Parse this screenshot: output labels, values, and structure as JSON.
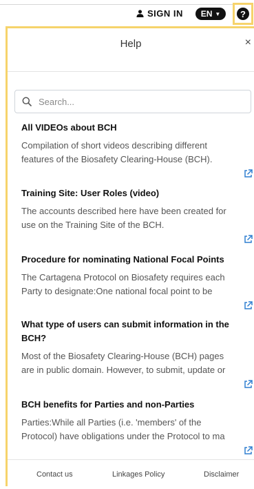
{
  "topbar": {
    "signin_label": "SIGN IN",
    "language": "EN",
    "help_icon": "question-circle-icon"
  },
  "help_panel": {
    "title": "Help",
    "close_symbol": "×",
    "search": {
      "placeholder": "Search..."
    },
    "articles": [
      {
        "title": "All VIDEOs about BCH",
        "description": "Compilation of short videos describing different features of the Biosafety Clearing-House (BCH)."
      },
      {
        "title": "Training Site: User Roles (video)",
        "description": "The accounts described here have been created for use on the Training Site of the BCH."
      },
      {
        "title": "Procedure for nominating National Focal Points",
        "description": "The Cartagena Protocol on Biosafety requires each Party to designate:One national focal point to be"
      },
      {
        "title": "What type of users can submit information in the BCH?",
        "description": "Most of the Biosafety Clearing-House (BCH) pages are in public domain. However, to submit, update or"
      },
      {
        "title": "BCH benefits for Parties and non-Parties",
        "description": "Parties:While all Parties (i.e. 'members' of the Protocol) have obligations under the Protocol to ma"
      }
    ],
    "footer": {
      "contact": "Contact us",
      "linkages": "Linkages Policy",
      "disclaimer": "Disclaimer"
    }
  },
  "colors": {
    "highlight_border": "#f6d36b",
    "link_icon": "#2f7fd0"
  }
}
